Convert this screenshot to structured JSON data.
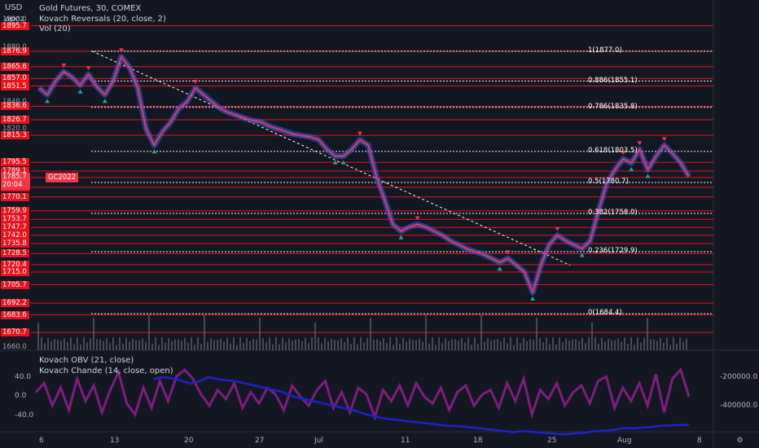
{
  "top_left": {
    "currency": "USD",
    "user": "apoz"
  },
  "legend": {
    "main": "Gold Futures, 30, COMEX",
    "indicator1": "Kovach Reversals (20, close, 2)",
    "indicator2": "Vol (20)",
    "lower1": "Kovach OBV (21, close)",
    "lower2": "Kovach Chande (14, close, open)"
  },
  "price_labels": [
    "1895.7",
    "1876.9",
    "1865.6",
    "1857.0",
    "1851.5",
    "1836.6",
    "1826.7",
    "1815.3",
    "1795.5",
    "1789.1",
    "1784.4",
    "1777.2",
    "1770.1",
    "1759.9",
    "1753.7",
    "1747.7",
    "1742.0",
    "1735.8",
    "1728.5",
    "1720.4",
    "1715.0",
    "1705.7",
    "1692.2",
    "1683.6",
    "1670.7"
  ],
  "faded_labels": [
    "1660.0",
    "1820.0",
    "1840.0",
    "1880.0",
    "1900.0"
  ],
  "current_price": {
    "price": "1785.7",
    "countdown": "20:04",
    "symbol": "GC2022"
  },
  "fib_levels": [
    "1(1877.0)",
    "0.886(1855.1)",
    "0.786(1835.8)",
    "0.618(1803.5)",
    "0.5(1780.7)",
    "0.382(1758.0)",
    "0.236(1729.9)",
    "0(1684.4)"
  ],
  "x_axis": [
    "6",
    "13",
    "20",
    "27",
    "Jul",
    "11",
    "18",
    "25",
    "Aug",
    "8"
  ],
  "lower_left_ticks": [
    "40.0",
    "0.0",
    "-40.0"
  ],
  "lower_right_ticks": [
    "-200000.0",
    "-400000.0"
  ],
  "nav_icon": "gear-icon",
  "colors": {
    "background": "#131722",
    "level": "#e8131c",
    "price_line": "#f23645",
    "candle_band": "#2962ff",
    "buy": "#26a69a",
    "sell": "#f23645",
    "osc": "#8b1e8b",
    "obv": "#1e22c9"
  },
  "chart_data": {
    "type": "line",
    "ylim": [
      1660,
      1905
    ],
    "support_resistance": [
      1895.7,
      1876.9,
      1865.6,
      1857.0,
      1851.5,
      1836.6,
      1826.7,
      1815.3,
      1795.5,
      1789.1,
      1784.4,
      1777.2,
      1770.1,
      1759.9,
      1753.7,
      1747.7,
      1742.0,
      1735.8,
      1728.5,
      1720.4,
      1715.0,
      1705.7,
      1692.2,
      1683.6,
      1670.7
    ],
    "fib_values": [
      1877.0,
      1855.1,
      1835.8,
      1803.5,
      1780.7,
      1758.0,
      1729.9,
      1684.4
    ],
    "price_series": [
      1850,
      1845,
      1855,
      1862,
      1858,
      1852,
      1860,
      1851,
      1845,
      1855,
      1873,
      1865,
      1850,
      1820,
      1808,
      1818,
      1825,
      1835,
      1840,
      1850,
      1845,
      1840,
      1835,
      1832,
      1830,
      1828,
      1826,
      1825,
      1822,
      1820,
      1818,
      1816,
      1815,
      1814,
      1812,
      1805,
      1800,
      1800,
      1805,
      1812,
      1808,
      1785,
      1768,
      1750,
      1745,
      1748,
      1750,
      1748,
      1745,
      1742,
      1738,
      1735,
      1732,
      1730,
      1728,
      1725,
      1722,
      1725,
      1720,
      1715,
      1700,
      1720,
      1735,
      1742,
      1738,
      1735,
      1732,
      1738,
      1760,
      1780,
      1790,
      1798,
      1795,
      1805,
      1790,
      1800,
      1808,
      1802,
      1795,
      1785
    ],
    "osc_series": [
      10,
      30,
      -20,
      20,
      -30,
      40,
      -10,
      25,
      -35,
      15,
      55,
      -15,
      -40,
      20,
      -25,
      35,
      -10,
      45,
      60,
      40,
      5,
      -20,
      15,
      -5,
      30,
      -25,
      10,
      -15,
      20,
      5,
      -30,
      25,
      0,
      -20,
      15,
      35,
      -25,
      10,
      -35,
      20,
      5,
      -45,
      15,
      -10,
      25,
      -20,
      30,
      0,
      -15,
      20,
      -30,
      10,
      25,
      -20,
      5,
      15,
      -25,
      30,
      -10,
      40,
      -40,
      15,
      -5,
      30,
      -20,
      10,
      25,
      -15,
      35,
      45,
      -25,
      20,
      -10,
      30,
      -20,
      50,
      -35,
      40,
      60,
      0
    ],
    "obv_series": [
      -210,
      -200,
      -205,
      -215,
      -230,
      -220,
      -200,
      -210,
      -215,
      -220,
      -230,
      -240,
      -250,
      -260,
      -270,
      -290,
      -300,
      -310,
      -320,
      -330,
      -340,
      -350,
      -360,
      -375,
      -385,
      -395,
      -400,
      -405,
      -410,
      -415,
      -420,
      -425,
      -430,
      -432,
      -435,
      -440,
      -445,
      -450,
      -455,
      -460,
      -455,
      -458,
      -462,
      -465,
      -470,
      -468,
      -465,
      -460,
      -455,
      -452,
      -448,
      -440,
      -442,
      -438,
      -435,
      -430,
      -428,
      -426,
      -425
    ]
  }
}
